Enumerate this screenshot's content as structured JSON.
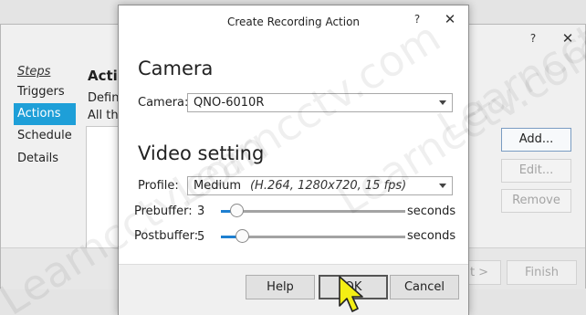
{
  "background_window": {
    "help_glyph": "?",
    "close_glyph": "✕",
    "steps_heading": "Steps",
    "steps": [
      {
        "label": "Triggers",
        "selected": false
      },
      {
        "label": "Actions",
        "selected": true
      },
      {
        "label": "Schedule",
        "selected": false
      },
      {
        "label": "Details",
        "selected": false
      }
    ],
    "section_title": "Actio",
    "description_line1": "Defin",
    "description_line2": "All the",
    "side_buttons": {
      "add": "Add...",
      "edit": "Edit...",
      "remove": "Remove"
    },
    "footer": {
      "next": "t >",
      "finish": "Finish"
    },
    "accent_color": "#1e9fd8"
  },
  "dialog": {
    "title": "Create Recording Action",
    "help_glyph": "?",
    "close_glyph": "✕",
    "camera_section": "Camera",
    "camera_label": "Camera:",
    "camera_value": "QNO-6010R",
    "video_section": "Video setting",
    "profile_label": "Profile:",
    "profile_value": "Medium",
    "profile_detail": "(H.264, 1280x720, 15 fps)",
    "prebuffer": {
      "label": "Prebuffer:",
      "value": "3",
      "unit": "seconds"
    },
    "postbuffer": {
      "label": "Postbuffer:",
      "value": "5",
      "unit": "seconds"
    },
    "buttons": {
      "help": "Help",
      "ok": "OK",
      "cancel": "Cancel"
    },
    "slider_fill_color": "#1e7fd0"
  },
  "watermark": "Learncctv.com",
  "cursor_icon": "yellow-arrow-cursor"
}
